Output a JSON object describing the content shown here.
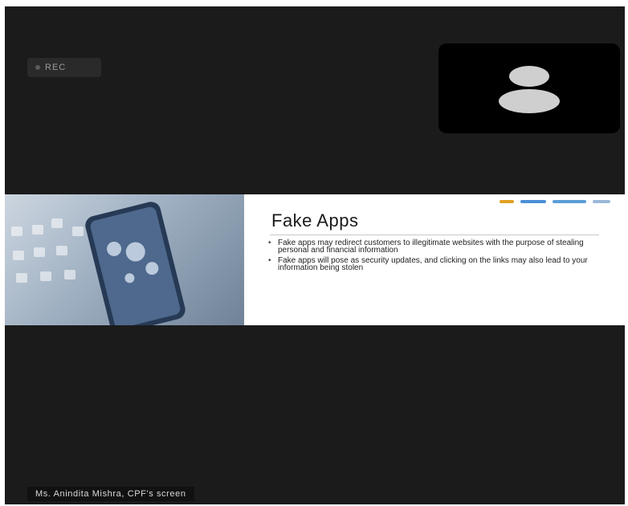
{
  "recording": {
    "label": "REC"
  },
  "participant": {
    "avatar_icon": "person-silhouette-icon"
  },
  "slide": {
    "title": "Fake Apps",
    "bullets": [
      "Fake apps may redirect customers to illegitimate websites with the purpose of stealing personal and financial information",
      "Fake apps will pose as security updates, and clicking on the links may also lead to your information being stolen"
    ],
    "image_icon": "smartphone-with-app-icons-image"
  },
  "share": {
    "label": "Ms. Anindita Mishra, CPF's screen"
  },
  "colors": {
    "background": "#1b1b1b",
    "tile": "#000000",
    "slide": "#ffffff"
  }
}
